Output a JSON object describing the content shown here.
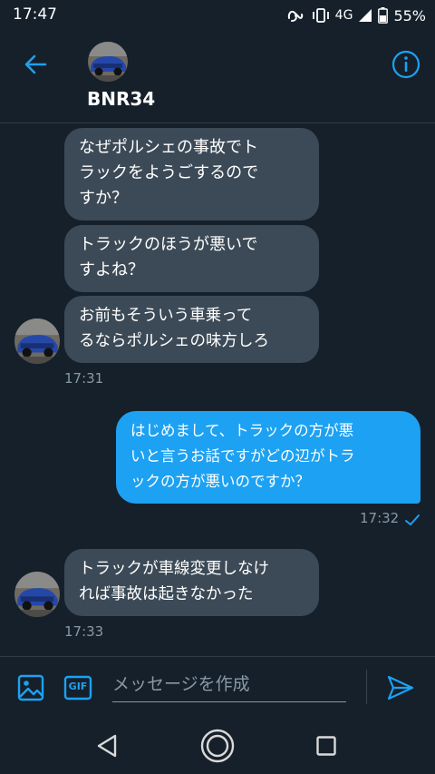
{
  "status_bar": {
    "time": "17:47",
    "network": "4G",
    "battery": "55%",
    "icons": [
      "nfc-icon",
      "vibrate-icon",
      "signal-icon",
      "battery-icon"
    ]
  },
  "header": {
    "name": "BNR34",
    "back_icon": "arrow-left-icon",
    "info_icon": "info-icon",
    "accent_color": "#1da1f2"
  },
  "messages": [
    {
      "direction": "in",
      "text": "なぜポルシェの事故でト\nラックをようごするので\nすか？"
    },
    {
      "direction": "in",
      "text": "トラックのほうが悪いで\nすよね？"
    },
    {
      "direction": "in",
      "text": "お前もそういう車乗って\nるならポルシェの味方しろ"
    },
    {
      "direction": "out",
      "text": "はじめまして、トラックの方が悪\nいと言うお話ですがどの辺がトラ\nックの方が悪いのですか？"
    },
    {
      "direction": "in",
      "text": "トラックが車線変更しなけ\nれば事故は起きなかった"
    }
  ],
  "timestamps": {
    "group1": "17:31",
    "group2": "17:32",
    "group3": "17:33"
  },
  "composer": {
    "placeholder": "メッセージを作成",
    "gif_label": "GIF",
    "image_icon": "image-icon",
    "send_icon": "send-icon"
  },
  "nav": {
    "icons": [
      "back-triangle-icon",
      "home-circle-icon",
      "recents-square-icon"
    ]
  },
  "colors": {
    "background": "#15202b",
    "incoming_bubble": "#3c4a57",
    "outgoing_bubble": "#1da1f2",
    "secondary_text": "#8899a6"
  }
}
